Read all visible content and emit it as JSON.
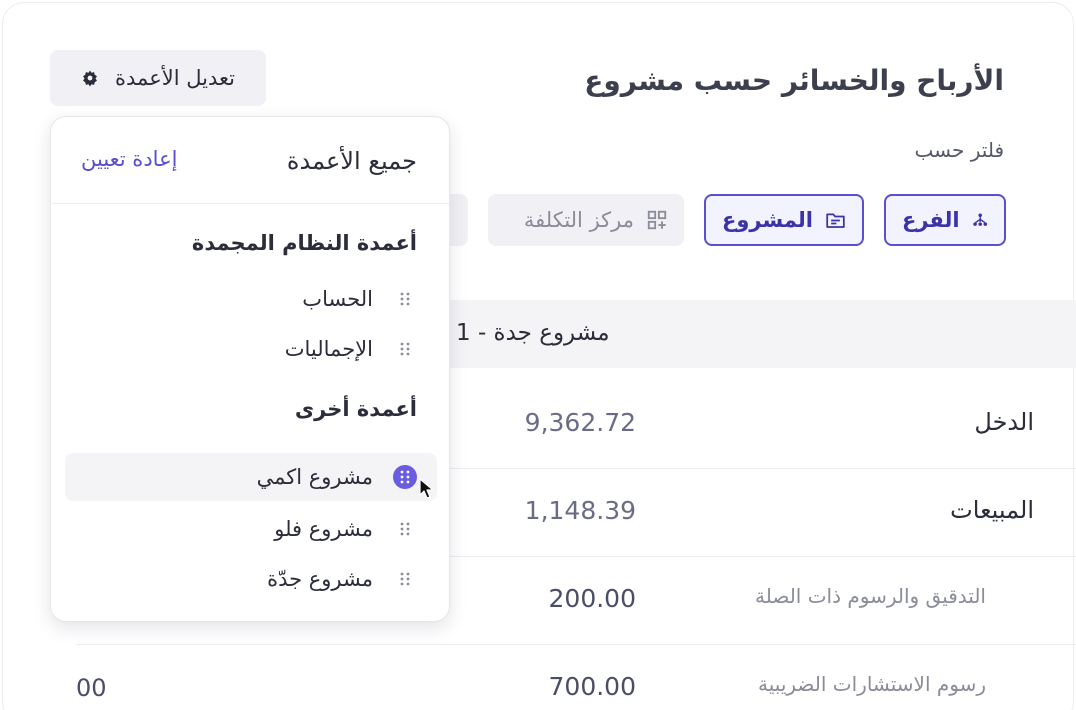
{
  "header": {
    "title": "الأرباح والخسائر حسب مشروع",
    "edit_columns_label": "تعديل الأعمدة",
    "edit_columns_icon": "gear-icon"
  },
  "filters": {
    "label": "فلتر حسب",
    "chips": [
      {
        "label": "الفرع",
        "icon": "branch-icon",
        "active": true
      },
      {
        "label": "المشروع",
        "icon": "folder-icon",
        "active": true
      },
      {
        "label": "مركز التكلفة",
        "icon": "grid-plus-icon",
        "active": false
      }
    ]
  },
  "table": {
    "section_header": "مشروع جدة - 1",
    "rows": [
      {
        "label": "الدخل",
        "value": "9,362.72",
        "extra": ""
      },
      {
        "label": "المبيعات",
        "value": "1,148.39",
        "extra": ""
      },
      {
        "label": "التدقيق والرسوم ذات الصلة",
        "value": "200.00",
        "extra": ""
      },
      {
        "label": "رسوم الاستشارات الضريبية",
        "value": "700.00",
        "extra": "00"
      }
    ]
  },
  "dropdown": {
    "title": "جميع الأعمدة",
    "reset_label": "إعادة تعيين",
    "frozen_group_label": "أعمدة النظام المجمدة",
    "frozen_items": [
      "الحساب",
      "الإجماليات"
    ],
    "other_group_label": "أعمدة أخرى",
    "other_items": [
      "مشروع اكمي",
      "مشروع فلو",
      "مشروع جدّة"
    ]
  },
  "colors": {
    "accent": "#5a4fcf",
    "text": "#2b2d3a",
    "muted": "#8a8c99",
    "value": "#6a6c86"
  }
}
